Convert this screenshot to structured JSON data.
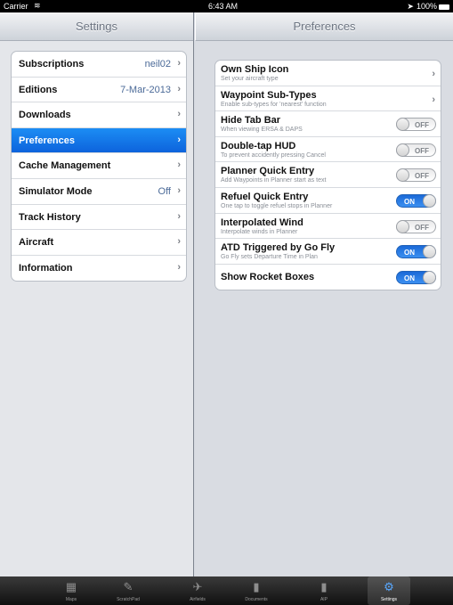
{
  "status_bar": {
    "carrier": "Carrier",
    "time": "6:43 AM",
    "battery": "100%"
  },
  "left_pane": {
    "title": "Settings",
    "items": [
      {
        "label": "Subscriptions",
        "value": "neil02",
        "selected": false
      },
      {
        "label": "Editions",
        "value": "7-Mar-2013",
        "selected": false
      },
      {
        "label": "Downloads",
        "value": "",
        "selected": false
      },
      {
        "label": "Preferences",
        "value": "",
        "selected": true
      },
      {
        "label": "Cache Management",
        "value": "",
        "selected": false
      },
      {
        "label": "Simulator Mode",
        "value": "Off",
        "selected": false
      },
      {
        "label": "Track History",
        "value": "",
        "selected": false
      },
      {
        "label": "Aircraft",
        "value": "",
        "selected": false
      },
      {
        "label": "Information",
        "value": "",
        "selected": false
      }
    ]
  },
  "right_pane": {
    "title": "Preferences",
    "items": [
      {
        "title": "Own Ship Icon",
        "subtitle": "Set your aircraft type",
        "control": "chevron"
      },
      {
        "title": "Waypoint Sub-Types",
        "subtitle": "Enable sub-types for 'nearest' function",
        "control": "chevron"
      },
      {
        "title": "Hide Tab Bar",
        "subtitle": "When viewing ERSA & DAPS",
        "control": "toggle",
        "state": "OFF"
      },
      {
        "title": "Double-tap HUD",
        "subtitle": "To prevent accidently pressing Cancel",
        "control": "toggle",
        "state": "OFF"
      },
      {
        "title": "Planner Quick Entry",
        "subtitle": "Add Waypoints in Planner start as text",
        "control": "toggle",
        "state": "OFF"
      },
      {
        "title": "Refuel Quick Entry",
        "subtitle": "One tap to toggle refuel stops in Planner",
        "control": "toggle",
        "state": "ON"
      },
      {
        "title": "Interpolated Wind",
        "subtitle": "Interpolate winds in Planner",
        "control": "toggle",
        "state": "OFF"
      },
      {
        "title": "ATD Triggered by Go Fly",
        "subtitle": "Go Fly sets Departure Time in Plan",
        "control": "toggle",
        "state": "ON"
      },
      {
        "title": "Show Rocket Boxes",
        "subtitle": "",
        "control": "toggle",
        "state": "ON"
      }
    ]
  },
  "tab_bar": {
    "tabs": [
      {
        "label": "Maps",
        "icon": "map-icon",
        "glyph": "▦",
        "selected": false
      },
      {
        "label": "ScratchPad",
        "icon": "scratchpad-icon",
        "glyph": "✎",
        "selected": false
      },
      {
        "label": "Airfields",
        "icon": "airplane-icon",
        "glyph": "✈",
        "selected": false
      },
      {
        "label": "Documents",
        "icon": "document-icon",
        "glyph": "▮",
        "selected": false
      },
      {
        "label": "AIP",
        "icon": "book-icon",
        "glyph": "▮",
        "selected": false
      },
      {
        "label": "Settings",
        "icon": "gear-icon",
        "glyph": "⚙",
        "selected": true
      }
    ]
  },
  "colors": {
    "selected_row": "#1478ea",
    "toggle_on": "#2a7ae6",
    "value_text": "#4b6a98"
  }
}
